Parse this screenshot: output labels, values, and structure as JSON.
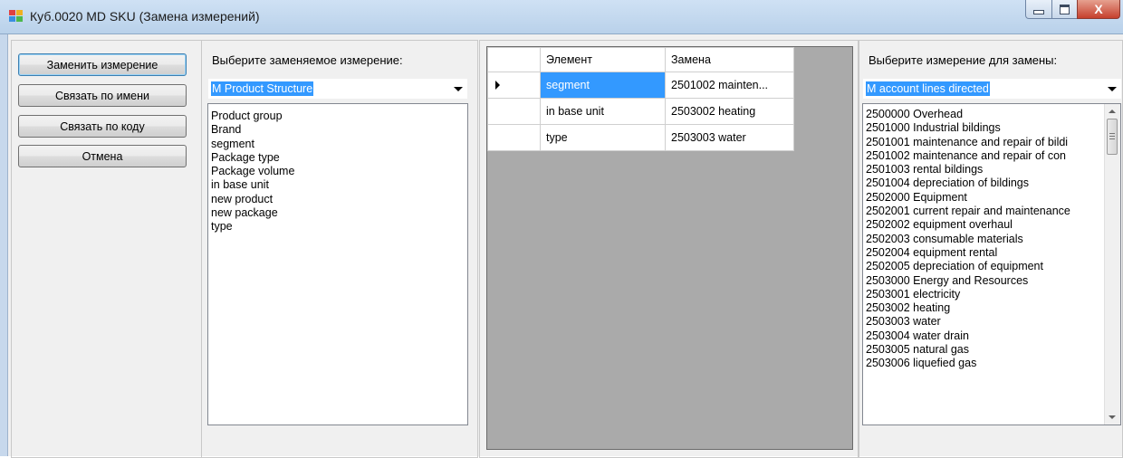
{
  "window": {
    "title": "Куб.0020 MD SKU (Замена измерений)",
    "close_glyph": "X"
  },
  "actions": {
    "replace_label": "Заменить измерение",
    "link_by_name_label": "Связать по имени",
    "link_by_code_label": "Связать по коду",
    "cancel_label": "Отмена"
  },
  "source": {
    "prompt": "Выберите заменяемое измерение:",
    "selected": "M Product Structure",
    "elements": [
      "Product group",
      "Brand",
      "segment",
      "Package type",
      "Package volume",
      "in base unit",
      "new product",
      "new package",
      "type"
    ]
  },
  "mapping_grid": {
    "headers": [
      "Элемент",
      "Замена"
    ],
    "rows": [
      {
        "element": "segment",
        "replacement": "2501002 mainten..."
      },
      {
        "element": "in base unit",
        "replacement": "2503002 heating"
      },
      {
        "element": "type",
        "replacement": "2503003 water"
      }
    ]
  },
  "target": {
    "prompt": "Выберите измерение для замены:",
    "selected": "M account lines directed",
    "elements": [
      "2500000 Overhead",
      "2501000 Industrial bildings",
      "2501001 maintenance and repair of bildi",
      "2501002 maintenance and repair of con",
      "2501003 rental bildings",
      "2501004 depreciation of bildings",
      "2502000 Equipment",
      "2502001 current repair and maintenance",
      "2502002 equipment overhaul",
      "2502003 consumable materials",
      "2502004 equipment rental",
      "2502005 depreciation of equipment",
      "2503000 Energy and Resources",
      "2503001 electricity",
      "2503002 heating",
      "2503003 water",
      "2503004 water drain",
      "2503005 natural gas",
      "2503006 liquefied gas"
    ]
  },
  "colors": {
    "selection": "#3399ff",
    "grid_background": "#aaaaaa",
    "title_bar": "#c4d9ef",
    "close_button": "#c6402d"
  }
}
